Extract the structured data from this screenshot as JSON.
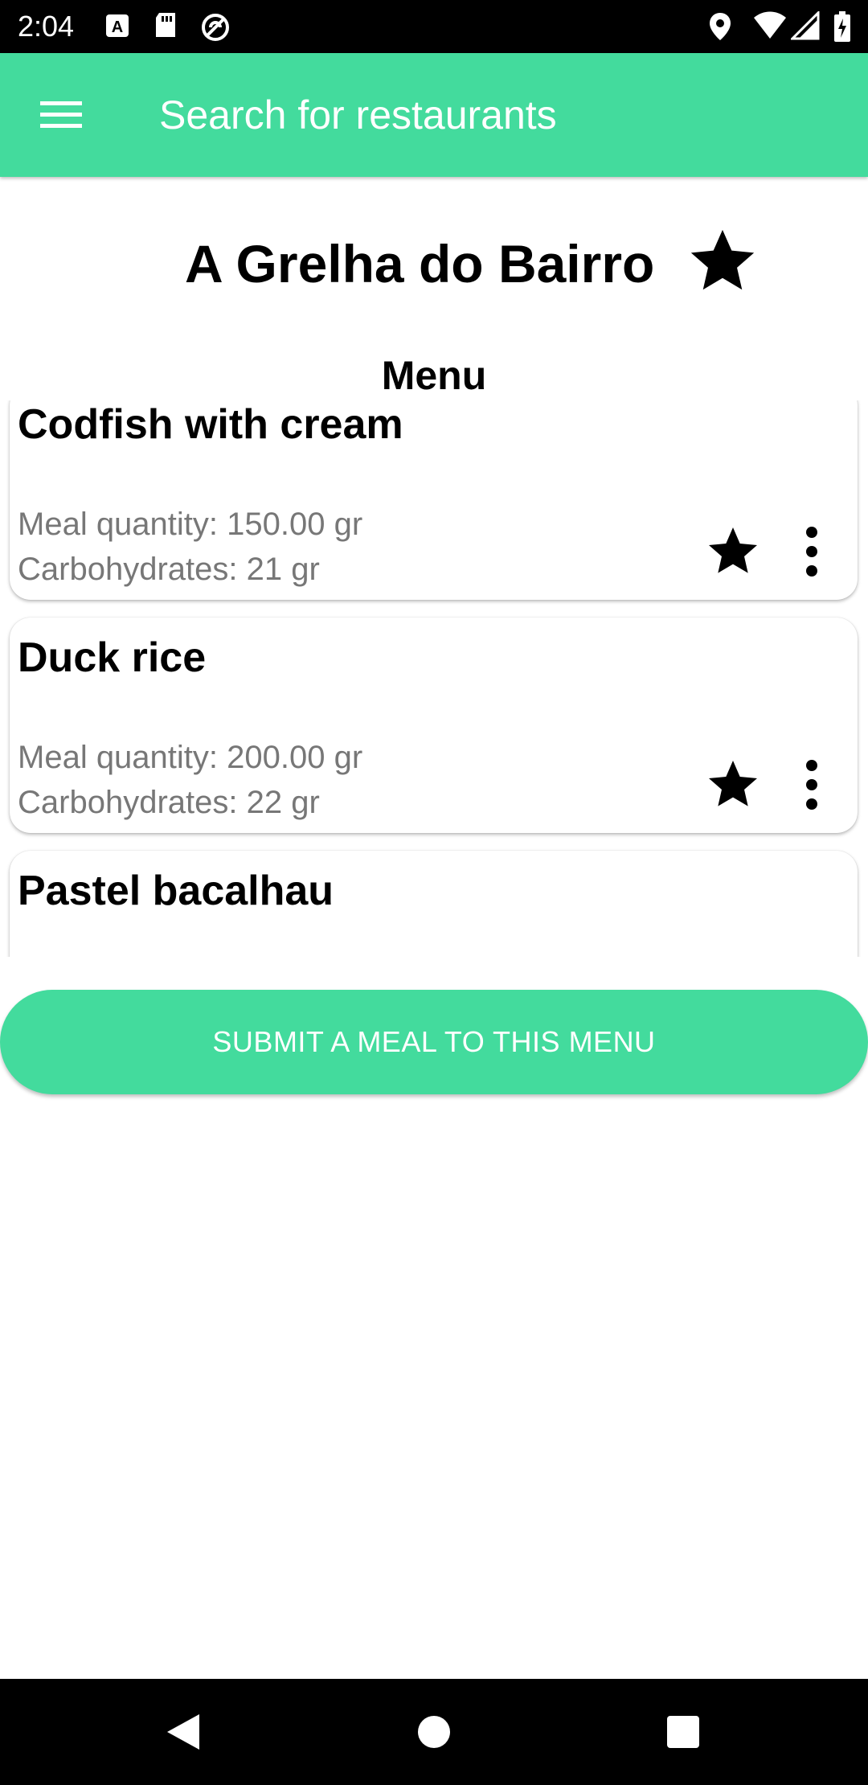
{
  "status_bar": {
    "time": "2:04",
    "icons": [
      "font-icon",
      "sd-card-icon",
      "sync-icon",
      "location-icon",
      "wifi-icon",
      "signal-icon",
      "battery-charging-icon"
    ]
  },
  "app_bar": {
    "menu_icon": "hamburger-menu-icon",
    "title": "Search for restaurants",
    "color": "#43db9d"
  },
  "restaurant": {
    "name": "A Grelha do Bairro",
    "favorite_icon": "star-icon"
  },
  "menu": {
    "heading": "Menu",
    "meals": [
      {
        "name": "Codfish with cream",
        "quantity": "Meal quantity: 150.00 gr",
        "carbohydrates": "Carbohydrates: 21 gr"
      },
      {
        "name": "Duck rice",
        "quantity": "Meal quantity: 200.00 gr",
        "carbohydrates": "Carbohydrates: 22 gr"
      },
      {
        "name": "Pastel bacalhau"
      }
    ]
  },
  "submit_button": {
    "label": "SUBMIT A MEAL TO THIS MENU"
  },
  "nav_bar": {
    "icons": [
      "back-icon",
      "home-icon",
      "recents-icon"
    ]
  }
}
